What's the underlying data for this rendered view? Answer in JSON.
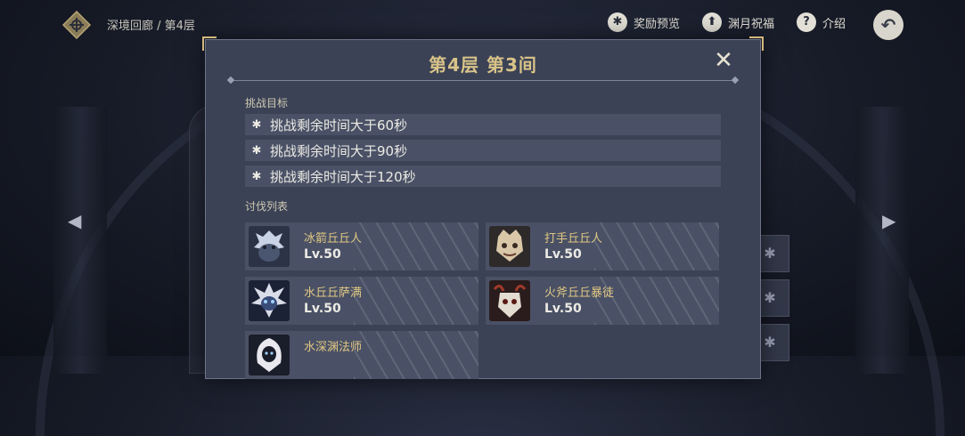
{
  "header": {
    "breadcrumb": "深境回廊 / 第4层",
    "nav": [
      {
        "label": "奖励预览",
        "icon": "star-icon"
      },
      {
        "label": "渊月祝福",
        "icon": "upload-icon"
      },
      {
        "label": "介绍",
        "icon": "help-icon"
      }
    ],
    "back_icon": "back-arrow-icon"
  },
  "modal": {
    "title": "第4层 第3间",
    "close_icon": "close-icon",
    "objectives_label": "挑战目标",
    "objectives": [
      "挑战剩余时间大于60秒",
      "挑战剩余时间大于90秒",
      "挑战剩余时间大于120秒"
    ],
    "enemies_label": "讨伐列表",
    "enemies": [
      {
        "name": "冰箭丘丘人",
        "level": "Lv.50",
        "portrait": "ice-archer-hilichurl-portrait"
      },
      {
        "name": "打手丘丘人",
        "level": "Lv.50",
        "portrait": "fighter-hilichurl-portrait"
      },
      {
        "name": "水丘丘萨满",
        "level": "Lv.50",
        "portrait": "hydro-samachurl-portrait"
      },
      {
        "name": "火斧丘丘暴徒",
        "level": "Lv.50",
        "portrait": "pyro-axe-mitachurl-portrait"
      },
      {
        "name": "水深渊法师",
        "level": "",
        "portrait": "hydro-abyss-mage-portrait"
      }
    ]
  },
  "colors": {
    "modal_bg": "#3b4255",
    "row_bg": "#4a5166",
    "title_gold": "#d8c389",
    "enemy_name_gold": "#e1c883"
  }
}
